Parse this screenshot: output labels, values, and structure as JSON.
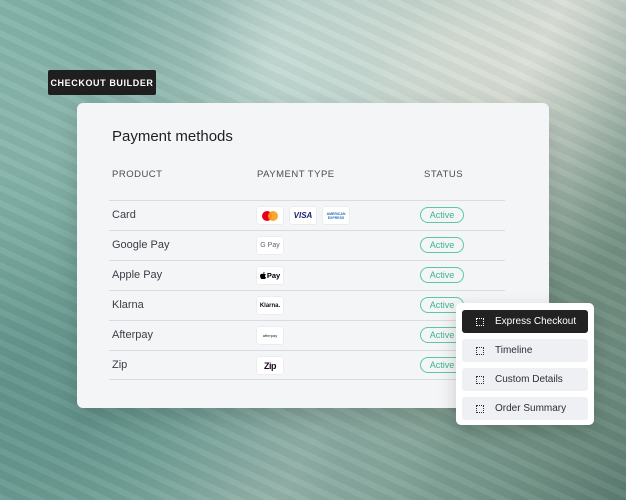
{
  "builder_tag": "CHECKOUT BUILDER",
  "panel": {
    "title": "Payment methods",
    "columns": [
      "PRODUCT",
      "PAYMENT TYPE",
      "STATUS"
    ],
    "rows": [
      {
        "product": "Card",
        "status": "Active",
        "logos": [
          "mastercard",
          "visa",
          "american-express"
        ]
      },
      {
        "product": "Google Pay",
        "status": "Active",
        "logos": [
          "google-pay"
        ]
      },
      {
        "product": "Apple Pay",
        "status": "Active",
        "logos": [
          "apple-pay"
        ]
      },
      {
        "product": "Klarna",
        "status": "Active",
        "logos": [
          "klarna"
        ]
      },
      {
        "product": "Afterpay",
        "status": "Active",
        "logos": [
          "afterpay"
        ]
      },
      {
        "product": "Zip",
        "status": "Active",
        "logos": [
          "zip"
        ]
      }
    ]
  },
  "logo_text": {
    "visa": "VISA",
    "amex": "AMERICAN EXPRESS",
    "gpay": "G Pay",
    "apay": "Pay",
    "klarna": "Klarna.",
    "afterpay": "afterpay",
    "zip": "Zip"
  },
  "menu": {
    "items": [
      {
        "label": "Express Checkout",
        "active": true
      },
      {
        "label": "Timeline",
        "active": false
      },
      {
        "label": "Custom Details",
        "active": false
      },
      {
        "label": "Order Summary",
        "active": false
      }
    ]
  },
  "colors": {
    "active_badge": "#3cb58a",
    "builder_tag_bg": "#1f1f1f",
    "menu_active_bg": "#222222"
  }
}
